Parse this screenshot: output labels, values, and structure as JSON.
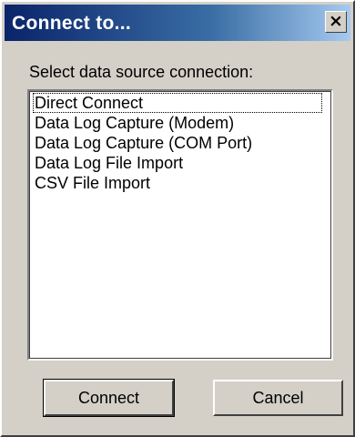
{
  "window": {
    "title": "Connect to...",
    "close_glyph": "✕"
  },
  "dialog": {
    "prompt": "Select data source connection:",
    "items": [
      {
        "label": "Direct Connect",
        "selected": true
      },
      {
        "label": "Data Log Capture (Modem)",
        "selected": false
      },
      {
        "label": "Data Log Capture (COM Port)",
        "selected": false
      },
      {
        "label": "Data Log File Import",
        "selected": false
      },
      {
        "label": "CSV File Import",
        "selected": false
      }
    ]
  },
  "buttons": {
    "connect_label": "Connect",
    "cancel_label": "Cancel"
  },
  "colors": {
    "titlebar_start": "#0a246a",
    "titlebar_end": "#a6caf0",
    "face": "#d4d0c8"
  }
}
